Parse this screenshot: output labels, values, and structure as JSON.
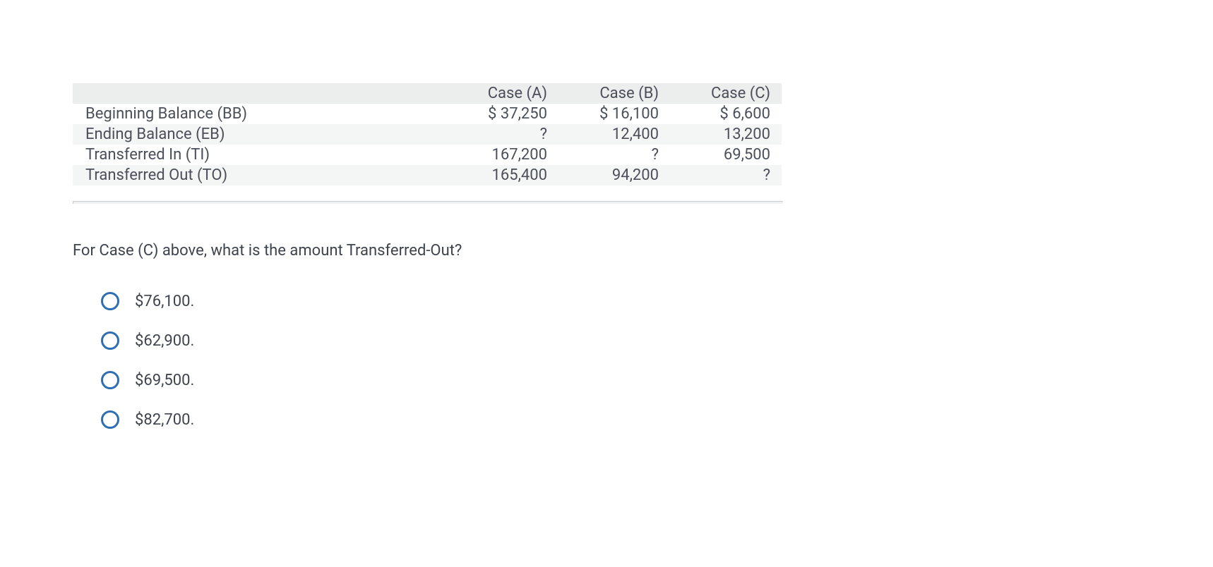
{
  "table": {
    "headers": {
      "label": "",
      "a": "Case (A)",
      "b": "Case (B)",
      "c": "Case (C)"
    },
    "rows": [
      {
        "label": "Beginning Balance (BB)",
        "a": "$  37,250",
        "b": "$  16,100",
        "c": "$  6,600"
      },
      {
        "label": "Ending Balance (EB)",
        "a": "?",
        "b": "12,400",
        "c": "13,200"
      },
      {
        "label": "Transferred In (TI)",
        "a": "167,200",
        "b": "?",
        "c": "69,500"
      },
      {
        "label": "Transferred Out (TO)",
        "a": "165,400",
        "b": "94,200",
        "c": "?"
      }
    ]
  },
  "question": "For Case (C) above, what is the amount Transferred-Out?",
  "options": [
    "$76,100.",
    "$62,900.",
    "$69,500.",
    "$82,700."
  ]
}
